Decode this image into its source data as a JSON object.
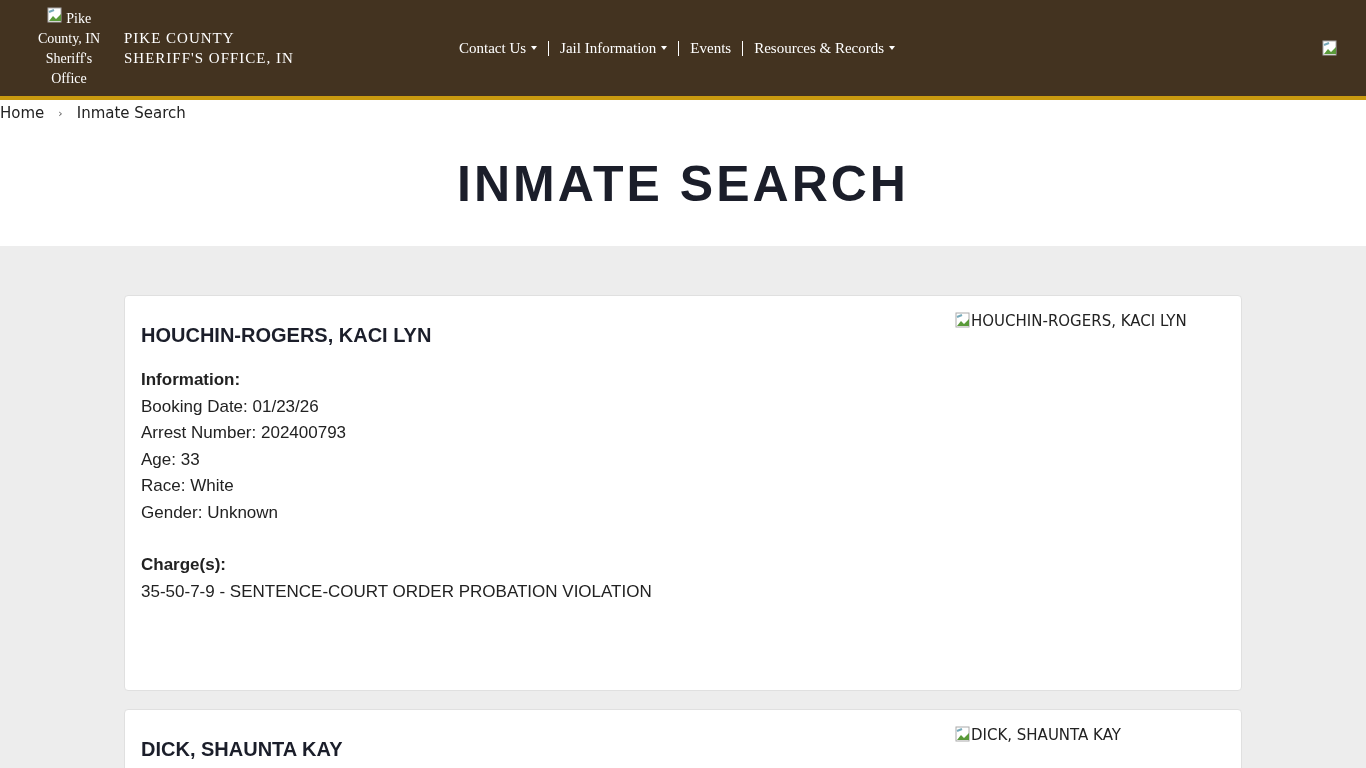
{
  "header": {
    "logo_alt": "Pike County, IN Sheriff's Office",
    "site_title": [
      "PIKE COUNTY",
      "SHERIFF'S OFFICE, IN"
    ],
    "nav": [
      {
        "label": "Contact Us",
        "dropdown": true
      },
      {
        "label": "Jail Information",
        "dropdown": true
      },
      {
        "label": "Events",
        "dropdown": false
      },
      {
        "label": "Resources & Records",
        "dropdown": true
      }
    ]
  },
  "breadcrumb": [
    "Home",
    "Inmate Search"
  ],
  "breadcrumb_separator": "›",
  "page_title": "INMATE SEARCH",
  "inmates": [
    {
      "name": "HOUCHIN-ROGERS, KACI LYN",
      "photo_alt": "HOUCHIN-ROGERS, KACI LYN",
      "info_heading": "Information:",
      "fields": [
        "Booking Date: 01/23/26",
        "Arrest Number: 202400793",
        "Age: 33",
        "Race: White",
        "Gender: Unknown"
      ],
      "charges_heading": "Charge(s):",
      "charges": [
        "35-50-7-9 - SENTENCE-COURT ORDER PROBATION VIOLATION"
      ]
    },
    {
      "name": "DICK, SHAUNTA KAY",
      "photo_alt": "DICK, SHAUNTA KAY"
    }
  ]
}
